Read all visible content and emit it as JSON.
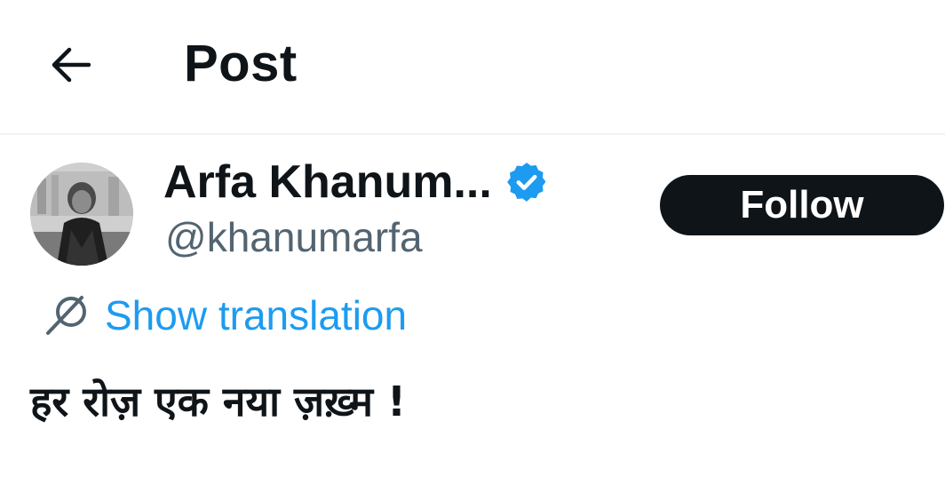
{
  "header": {
    "title": "Post",
    "back_icon": "arrow-left-icon"
  },
  "author": {
    "display_name": "Arfa Khanum...",
    "handle": "@khanumarfa",
    "verified": true,
    "verified_icon": "verified-badge-icon",
    "avatar_icon": "avatar-photo"
  },
  "actions": {
    "follow_label": "Follow"
  },
  "translation": {
    "icon": "translate-globe-icon",
    "label": "Show translation"
  },
  "post": {
    "text": "हर रोज़ एक नया ज़ख़्म !"
  },
  "colors": {
    "accent": "#1d9bf0",
    "text": "#0f1419",
    "secondary": "#536471",
    "button_bg": "#0f1419",
    "divider": "#eff3f4"
  }
}
